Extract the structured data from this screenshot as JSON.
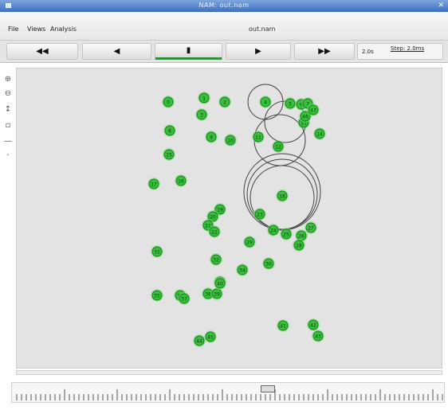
{
  "window": {
    "title": "NAM: out.nam"
  },
  "menu": {
    "file": "File",
    "views": "Views",
    "analysis": "Analysis",
    "filename": "out.nam"
  },
  "controls": {
    "buttons": [
      {
        "name": "rewind-button",
        "label": "◀◀"
      },
      {
        "name": "back-button",
        "label": "◀"
      },
      {
        "name": "stop-button",
        "label": "▮"
      },
      {
        "name": "play-button",
        "label": "▶"
      },
      {
        "name": "fast-forward-button",
        "label": "▶▶"
      }
    ],
    "active_button": "stop-button",
    "time_label": "2.0s",
    "step_label": "Step: 2.0ms"
  },
  "tools": [
    "zoom-in-icon",
    "zoom-out-icon",
    "pan-icon",
    "select-icon",
    "edit-icon",
    "link-icon"
  ],
  "colors": {
    "node_fill": "#38c03c",
    "node_stroke": "#1b7a1e",
    "node_glow": "#7fe07f",
    "range_circle": "#444444"
  },
  "nodes": [
    {
      "id": "0"
    },
    {
      "id": "1"
    },
    {
      "id": "2"
    },
    {
      "id": "3"
    },
    {
      "id": "4"
    },
    {
      "id": "5"
    },
    {
      "id": "6"
    },
    {
      "id": "7"
    },
    {
      "id": "8"
    },
    {
      "id": "9"
    },
    {
      "id": "10"
    },
    {
      "id": "11"
    },
    {
      "id": "12"
    },
    {
      "id": "13"
    },
    {
      "id": "14"
    },
    {
      "id": "15"
    },
    {
      "id": "16"
    },
    {
      "id": "17"
    },
    {
      "id": "18"
    },
    {
      "id": "19"
    },
    {
      "id": "20"
    },
    {
      "id": "21"
    },
    {
      "id": "22"
    },
    {
      "id": "23"
    },
    {
      "id": "24"
    },
    {
      "id": "25"
    },
    {
      "id": "26"
    },
    {
      "id": "27"
    },
    {
      "id": "28"
    },
    {
      "id": "29"
    },
    {
      "id": "30"
    },
    {
      "id": "31"
    },
    {
      "id": "32"
    },
    {
      "id": "33"
    },
    {
      "id": "34"
    },
    {
      "id": "35"
    },
    {
      "id": "36"
    },
    {
      "id": "37"
    },
    {
      "id": "38"
    },
    {
      "id": "39"
    },
    {
      "id": "40"
    },
    {
      "id": "41"
    },
    {
      "id": "42"
    },
    {
      "id": "43"
    },
    {
      "id": "44"
    },
    {
      "id": "45"
    },
    {
      "id": "46"
    },
    {
      "id": "47"
    }
  ],
  "timeline": {
    "position": 0.6
  }
}
